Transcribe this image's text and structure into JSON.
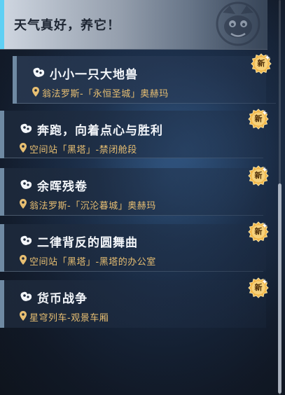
{
  "header": {
    "title": "天气真好，养它！"
  },
  "missions": [
    {
      "title": "小小一只大地兽",
      "location": "翁法罗斯-「永恒圣城」奥赫玛",
      "badge": "新",
      "selected": true
    },
    {
      "title": "奔跑，向着点心与胜利",
      "location": "空间站「黑塔」-禁闭舱段",
      "badge": "新"
    },
    {
      "title": "余晖残卷",
      "location": "翁法罗斯-「沉沦暮城」奥赫玛",
      "badge": "新"
    },
    {
      "title": "二律背反的圆舞曲",
      "location": "空间站「黑塔」-黑塔的办公室",
      "badge": "新"
    },
    {
      "title": "货币战争",
      "location": "星穹列车-观景车厢",
      "badge": "新"
    }
  ],
  "colors": {
    "accent": "#5fd0f4",
    "location": "#e8bf72",
    "badge": "#f1b74a"
  },
  "icons": {
    "mission": "mission-type-icon",
    "location": "location-pin-icon",
    "badge": "new-badge-icon",
    "mascot": "mascot-emblem-icon"
  }
}
